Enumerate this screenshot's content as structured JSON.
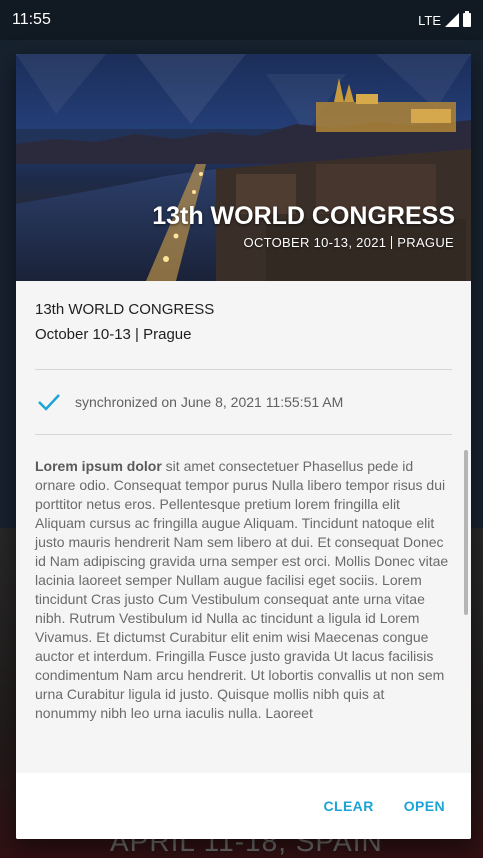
{
  "status_bar": {
    "time": "11:55",
    "network": "LTE"
  },
  "background": {
    "banner_text": "APRIL 11-18, SPAIN"
  },
  "dialog": {
    "hero": {
      "title": "13th WORLD CONGRESS",
      "subtitle_dates": "OCTOBER 10-13, 2021",
      "subtitle_city": "PRAGUE"
    },
    "event_name": "13th WORLD CONGRESS",
    "event_date": "October 10-13 | Prague",
    "sync_status": "synchronized on June 8, 2021 11:55:51 AM",
    "description_lead": "Lorem ipsum dolor",
    "description_body": " sit amet consectetuer Phasellus pede id ornare odio. Consequat tempor purus Nulla libero tempor risus dui porttitor netus eros. Pellentesque pretium lorem fringilla elit Aliquam cursus ac fringilla augue Aliquam. Tincidunt natoque elit justo mauris hendrerit Nam sem libero at dui. Et consequat Donec id Nam adipiscing gravida urna semper est orci. Mollis Donec vitae lacinia laoreet semper Nullam augue facilisi eget sociis. Lorem tincidunt Cras justo Cum Vestibulum consequat ante urna vitae nibh. Rutrum Vestibulum id Nulla ac tincidunt a ligula id Lorem Vivamus. Et dictumst Curabitur elit enim wisi Maecenas congue auctor et interdum. Fringilla Fusce justo gravida Ut lacus facilisis condimentum Nam arcu hendrerit. Ut lobortis convallis ut non sem urna Curabitur ligula id justo. Quisque mollis nibh quis at nonummy nibh leo urna iaculis nulla. Laoreet",
    "actions": {
      "clear": "CLEAR",
      "open": "OPEN"
    }
  },
  "colors": {
    "accent": "#1ca3d8",
    "check": "#1ca3d8"
  }
}
